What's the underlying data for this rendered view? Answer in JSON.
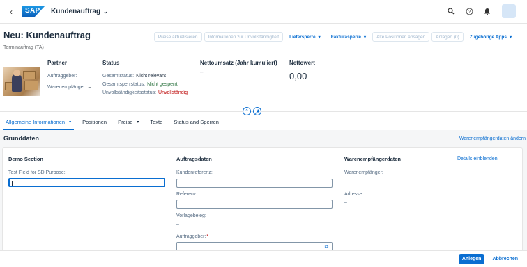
{
  "shell": {
    "logo_text": "SAP",
    "app_title": "Kundenauftrag",
    "icons": [
      "back-icon",
      "search-icon",
      "help-icon",
      "bell-icon"
    ]
  },
  "header": {
    "title": "Neu: Kundenauftrag",
    "subtitle": "Terminauftrag (TA)",
    "actions": [
      {
        "label": "Preise aktualisieren",
        "type": "disabled"
      },
      {
        "label": "Informationen zur Unvollständigkeit",
        "type": "disabled"
      },
      {
        "label": "Liefersperre",
        "type": "menu"
      },
      {
        "label": "Fakturasperre",
        "type": "menu"
      },
      {
        "label": "Alte Positionen absagen",
        "type": "disabled"
      },
      {
        "label": "Anlagen (0)",
        "type": "disabled"
      },
      {
        "label": "Zugehörige Apps",
        "type": "menu"
      }
    ],
    "partner": {
      "label": "Partner",
      "auftraggeber_label": "Auftraggeber:",
      "auftraggeber_value": "–",
      "warenempfaenger_label": "Warenempfänger:",
      "warenempfaenger_value": "–"
    },
    "status": {
      "label": "Status",
      "gesamtstatus_label": "Gesamtstatus:",
      "gesamtstatus_value": "Nicht relevant",
      "gesamtsperrstatus_label": "Gesamtsperrstatus:",
      "gesamtsperrstatus_value": "Nicht gesperrt",
      "unvollstaendigkeit_label": "Unvollständigkeitsstatus:",
      "unvollstaendigkeit_value": "Unvollständig"
    },
    "nettoumsatz": {
      "label": "Nettoumsatz (Jahr kumuliert)",
      "value": "–"
    },
    "nettowert": {
      "label": "Nettowert",
      "value": "0,00"
    }
  },
  "tabs": [
    {
      "label": "Allgemeine Informationen",
      "active": true,
      "dropdown": true
    },
    {
      "label": "Positionen",
      "active": false,
      "dropdown": false
    },
    {
      "label": "Preise",
      "active": false,
      "dropdown": true
    },
    {
      "label": "Texte",
      "active": false,
      "dropdown": false
    },
    {
      "label": "Status and Sperren",
      "active": false,
      "dropdown": false
    }
  ],
  "content": {
    "section_title": "Grunddaten",
    "top_link": "Warenempfängerdaten ändern",
    "demo": {
      "heading": "Demo Section",
      "field_label": "Test Field for SD Purpose:",
      "field_value": ""
    },
    "auftragsdaten": {
      "heading": "Auftragsdaten",
      "kundenreferenz_label": "Kundenreferenz:",
      "referenz_label": "Referenz:",
      "vorlagebeleg_label": "Vorlagebeleg:",
      "vorlagebeleg_value": "–",
      "auftraggeber_label": "Auftraggeber:",
      "auftraggeber_required": "*"
    },
    "warenempfaenger": {
      "heading": "Warenempfängerdaten",
      "details_link": "Details einblenden",
      "we_label": "Warenempfänger:",
      "we_value": "–",
      "adresse_label": "Adresse:",
      "adresse_value": "–"
    }
  },
  "footer": {
    "create_label": "Anlegen",
    "cancel_label": "Abbrechen"
  },
  "colors": {
    "accent": "#0a6ed1",
    "error": "#bb0000",
    "success": "#256f3a"
  }
}
